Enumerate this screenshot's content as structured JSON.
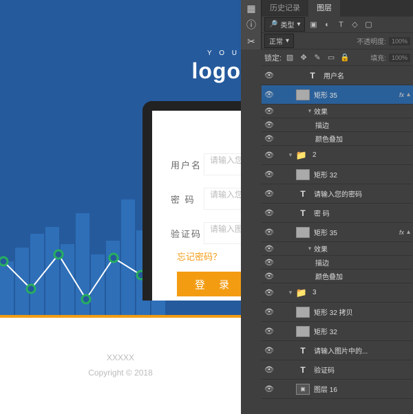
{
  "hero": {
    "logo": "logo",
    "logo_tag": "Y O U"
  },
  "form": {
    "username_label": "用户名",
    "username_ph": "请输入您",
    "password_label": "密  码",
    "password_ph": "请输入您",
    "captcha_label": "验证码",
    "captcha_ph": "请输入图",
    "forgot": "忘记密码？",
    "login": "登  录"
  },
  "footer": {
    "line1": "XXXXX",
    "line2": "Copyright © 2018"
  },
  "ps": {
    "tabs": {
      "history": "历史记录",
      "layers": "图层"
    },
    "type_label": "类型",
    "blend": "正常",
    "opacity_label": "不透明度:",
    "opacity_val": "100%",
    "lock_label": "锁定:",
    "fill_label": "填充:",
    "fill_val": "100%"
  },
  "layers": [
    {
      "kind": "text",
      "indent": 3,
      "name": "用户名"
    },
    {
      "kind": "rect",
      "indent": 2,
      "name": "矩形 35",
      "fx": true,
      "selected": true
    },
    {
      "kind": "effect-head",
      "indent": 3,
      "name": "效果"
    },
    {
      "kind": "effect",
      "indent": 4,
      "name": "描边"
    },
    {
      "kind": "effect",
      "indent": 4,
      "name": "颜色叠加"
    },
    {
      "kind": "folder",
      "indent": 1,
      "name": "2",
      "open": true
    },
    {
      "kind": "rect",
      "indent": 2,
      "name": "矩形 32"
    },
    {
      "kind": "text",
      "indent": 2,
      "name": "请输入您的密码"
    },
    {
      "kind": "text",
      "indent": 2,
      "name": "密  码"
    },
    {
      "kind": "rect",
      "indent": 2,
      "name": "矩形 35",
      "fx": true
    },
    {
      "kind": "effect-head",
      "indent": 3,
      "name": "效果"
    },
    {
      "kind": "effect",
      "indent": 4,
      "name": "描边"
    },
    {
      "kind": "effect",
      "indent": 4,
      "name": "颜色叠加"
    },
    {
      "kind": "folder",
      "indent": 1,
      "name": "3",
      "open": true
    },
    {
      "kind": "rect",
      "indent": 2,
      "name": "矩形 32 拷贝"
    },
    {
      "kind": "rect",
      "indent": 2,
      "name": "矩形 32"
    },
    {
      "kind": "text",
      "indent": 2,
      "name": "请输入图片中的..."
    },
    {
      "kind": "text",
      "indent": 2,
      "name": "验证码"
    },
    {
      "kind": "smart",
      "indent": 2,
      "name": "图层 16"
    }
  ],
  "chart_data": {
    "type": "line+bar",
    "note": "decorative city-bars with stat line, values estimated by height",
    "bars": [
      40,
      55,
      70,
      80,
      60,
      90,
      50,
      65,
      100,
      75,
      85,
      60,
      70
    ],
    "line_points": [
      {
        "x": 0,
        "y": 55
      },
      {
        "x": 1,
        "y": 30
      },
      {
        "x": 2,
        "y": 62
      },
      {
        "x": 3,
        "y": 22
      },
      {
        "x": 4,
        "y": 60
      },
      {
        "x": 5,
        "y": 40
      },
      {
        "x": 6,
        "y": 75
      }
    ]
  }
}
